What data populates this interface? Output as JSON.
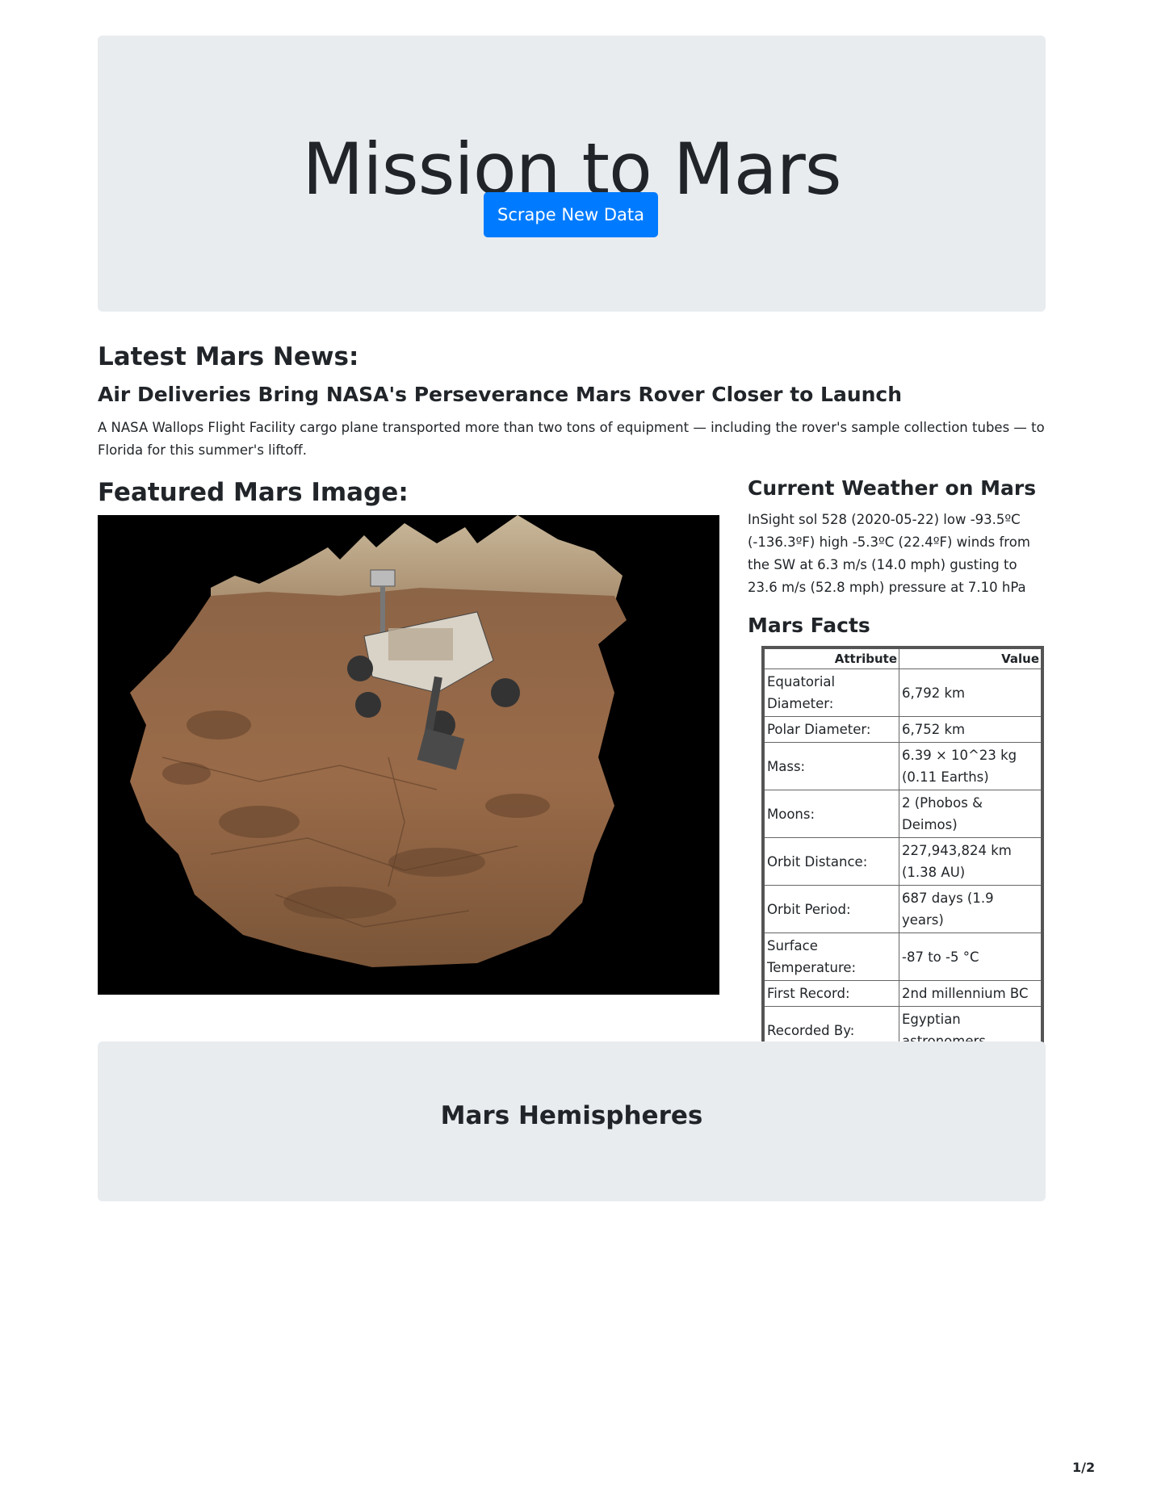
{
  "header": {
    "title": "Mission to Mars",
    "button_label": "Scrape New Data"
  },
  "news": {
    "section_title": "Latest Mars News:",
    "headline": "Air Deliveries Bring NASA's Perseverance Mars Rover Closer to Launch",
    "paragraph": "A NASA Wallops Flight Facility cargo plane transported more than two tons of equipment — including the rover's sample collection tubes — to Florida for this summer's liftoff."
  },
  "featured_image": {
    "section_title": "Featured Mars Image:"
  },
  "weather": {
    "section_title": "Current Weather on Mars",
    "text": "InSight sol 528 (2020-05-22) low -93.5ºC (-136.3ºF) high -5.3ºC (22.4ºF) winds from the SW at 6.3 m/s (14.0 mph) gusting to 23.6 m/s (52.8 mph) pressure at 7.10 hPa"
  },
  "facts": {
    "section_title": "Mars Facts",
    "columns": [
      "Attribute",
      "Value"
    ],
    "rows": [
      [
        "Equatorial Diameter:",
        "6,792 km"
      ],
      [
        "Polar Diameter:",
        "6,752 km"
      ],
      [
        "Mass:",
        "6.39 × 10^23 kg (0.11 Earths)"
      ],
      [
        "Moons:",
        "2 (Phobos & Deimos)"
      ],
      [
        "Orbit Distance:",
        "227,943,824 km (1.38 AU)"
      ],
      [
        "Orbit Period:",
        "687 days (1.9 years)"
      ],
      [
        "Surface Temperature:",
        "-87 to -5 °C"
      ],
      [
        "First Record:",
        "2nd millennium BC"
      ],
      [
        "Recorded By:",
        "Egyptian astronomers"
      ]
    ]
  },
  "hemispheres": {
    "section_title": "Mars Hemispheres"
  },
  "footer": {
    "page_number": "1/2"
  },
  "colors": {
    "jumbotron_bg": "#e9ecef",
    "button_bg": "#007bff",
    "text": "#212529"
  }
}
